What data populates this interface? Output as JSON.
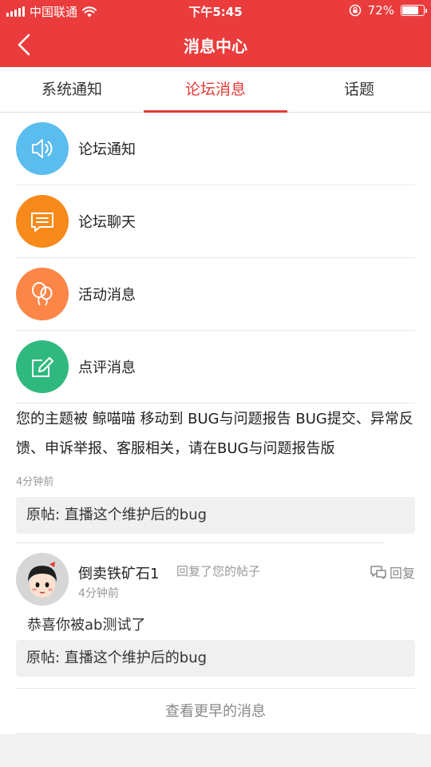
{
  "status_bar": {
    "carrier": "中国联通",
    "time": "下午5:45",
    "battery": "72%",
    "battery_level": 0.72
  },
  "header": {
    "title": "消息中心",
    "back_icon": "chevron-left-icon"
  },
  "tabs": [
    {
      "label": "系统通知",
      "active": false
    },
    {
      "label": "论坛消息",
      "active": true
    },
    {
      "label": "话题",
      "active": false
    }
  ],
  "categories": [
    {
      "label": "论坛通知",
      "icon": "speaker-icon",
      "color": "#5bbdee"
    },
    {
      "label": "论坛聊天",
      "icon": "chat-bubble-icon",
      "color": "#f78a1a"
    },
    {
      "label": "活动消息",
      "icon": "balloon-icon",
      "color": "#fb8647"
    },
    {
      "label": "点评消息",
      "icon": "edit-icon",
      "color": "#30b97f"
    }
  ],
  "notice": {
    "text": "您的主题被 鲸喵喵 移动到 BUG与问题报告 BUG提交、异常反馈、申诉举报、客服相关，请在BUG与问题报告版",
    "time": "4分钟前",
    "original_post": "原帖: 直播这个维护后的bug"
  },
  "reply": {
    "username": "倒卖铁矿石1",
    "action": "回复了您的帖子",
    "time": "4分钟前",
    "reply_button": "回复",
    "content": "恭喜你被ab测试了",
    "original_post": "原帖: 直播这个维护后的bug"
  },
  "footer": {
    "more_label": "查看更早的消息"
  },
  "colors": {
    "brand": "#ea3c3c",
    "active_tab": "#e53935"
  }
}
